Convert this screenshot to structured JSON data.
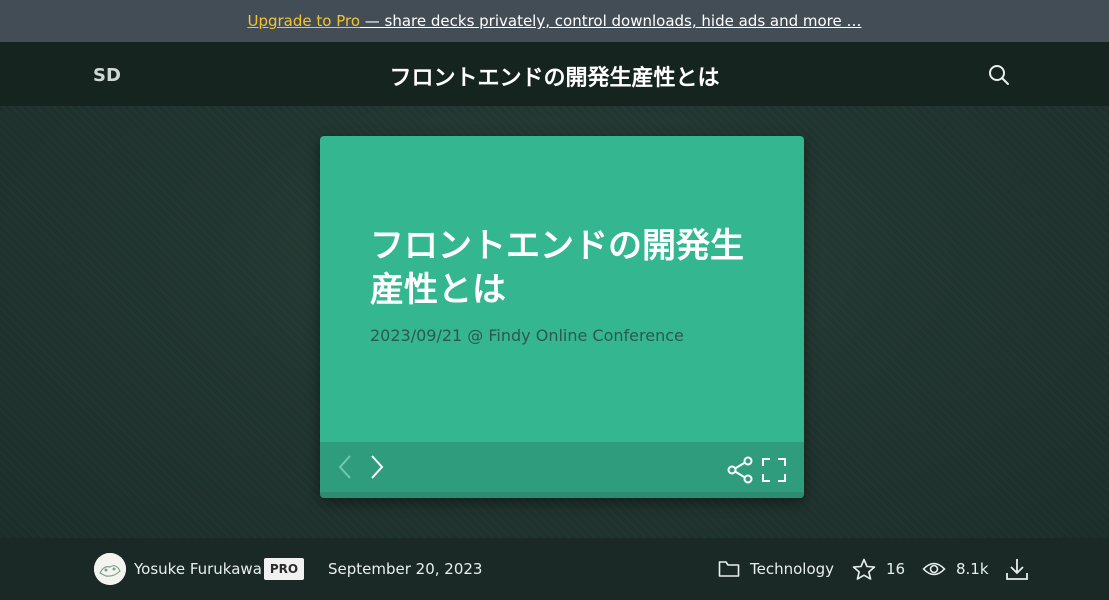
{
  "promo": {
    "upgrade_label": "Upgrade to Pro",
    "rest_label": " — share decks privately, control downloads, hide ads and more …",
    "accent_color": "#f4c430"
  },
  "header": {
    "logo_text": "SD",
    "title": "フロントエンドの開発生産性とは",
    "search_icon": "search-icon"
  },
  "slide": {
    "title": "フロントエンドの開発生産性とは",
    "subtitle": "2023/09/21 @ Findy Online Conference",
    "background_color": "#34b690",
    "icons": [
      "chevron-left-icon",
      "chevron-right-icon",
      "share-icon",
      "fullscreen-icon"
    ]
  },
  "meta": {
    "author": "Yosuke Furukawa",
    "badge": "PRO",
    "date": "September 20, 2023",
    "category": "Technology",
    "stars": "16",
    "views": "8.1k",
    "icons": [
      "folder-icon",
      "star-icon",
      "eye-icon",
      "download-icon"
    ]
  }
}
